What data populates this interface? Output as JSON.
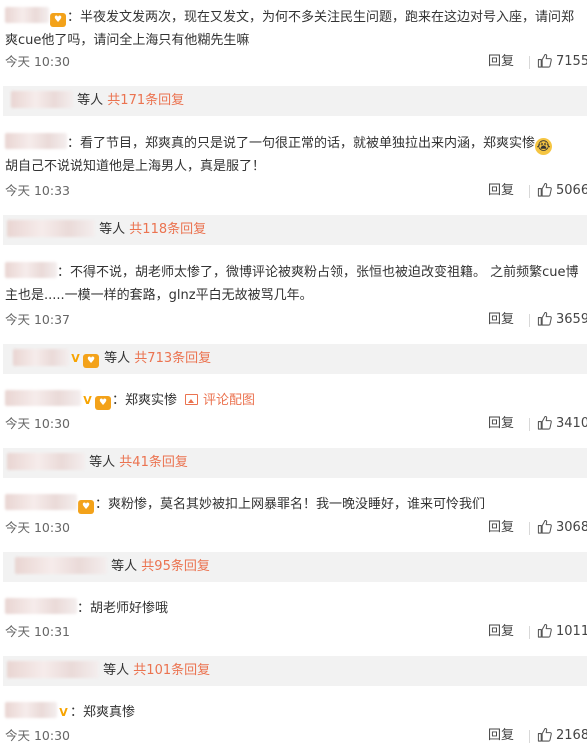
{
  "ui": {
    "reply_label": "回复",
    "others_label": "等人",
    "thumb_icon": "thumbs-up-icon",
    "accent_color": "#eb7350",
    "bar_color": "#f2f2f2"
  },
  "comments": [
    {
      "text": "：半夜发文发两次，现在又发文，为何不多关注民生问题，跑来在这边对号入座，请问郑爽cue他了吗，请问全上海只有他糊先生嘛",
      "time": "今天 10:30",
      "likes": "7155",
      "reply_bar": {
        "total": "共171条回复"
      }
    },
    {
      "text": "：看了节目，郑爽真的只是说了一句很正常的话，就被单独拉出来内涵，郑爽实惨",
      "text2": "胡自己不说说知道他是上海男人，真是服了！",
      "emoji": "crying-face-emoji",
      "time": "今天 10:33",
      "likes": "5066",
      "reply_bar": {
        "total": "共118条回复"
      }
    },
    {
      "text": "：不得不说，胡老师太惨了，微博评论被爽粉占领，张恒也被迫改变祖籍。 之前频繁cue博主也是.....一模一样的套路，glnz平白无故被骂几年。",
      "time": "今天 10:37",
      "likes": "3659",
      "reply_bar": {
        "total": "共713条回复"
      }
    },
    {
      "text": "：郑爽实惨",
      "pic_link": "评论配图",
      "time": "今天 10:30",
      "likes": "3410",
      "reply_bar": {
        "total": "共41条回复"
      }
    },
    {
      "text": "：爽粉惨，莫名其妙被扣上网暴罪名！我一晚没睡好，谁来可怜我们",
      "time": "今天 10:30",
      "likes": "3068",
      "reply_bar": {
        "total": "共95条回复"
      }
    },
    {
      "text": "：胡老师好惨哦",
      "time": "今天 10:31",
      "likes": "1011",
      "reply_bar": {
        "total": "共101条回复"
      }
    },
    {
      "text": "：郑爽真惨",
      "time": "今天 10:30",
      "likes": "2168"
    }
  ]
}
